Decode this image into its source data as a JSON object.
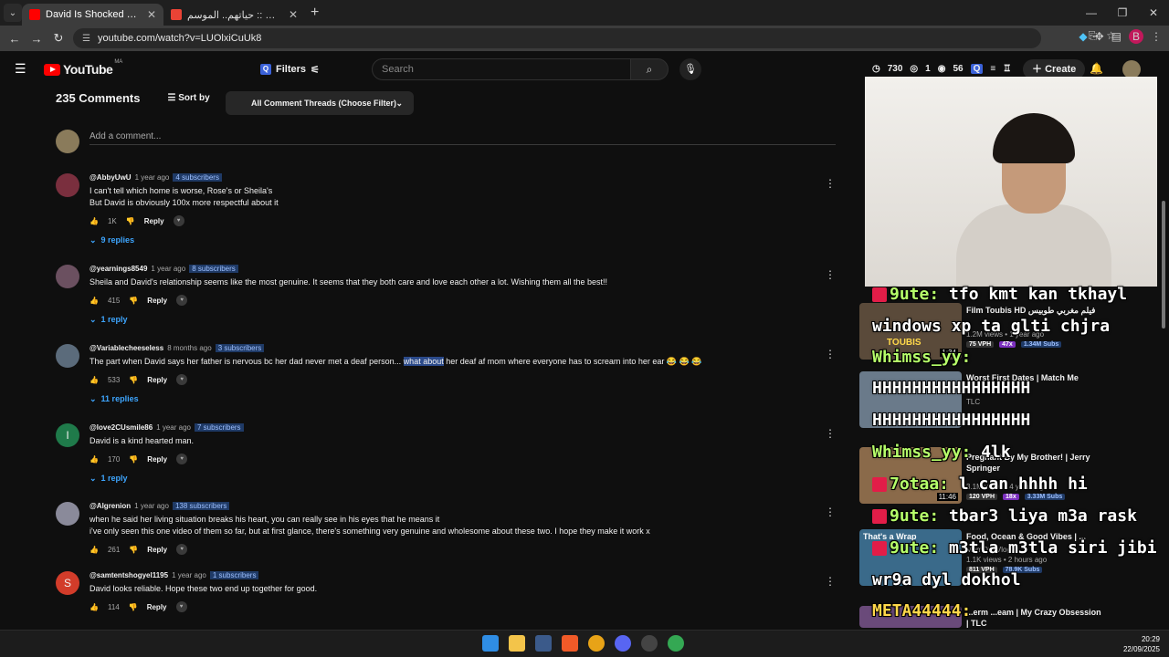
{
  "browser": {
    "tabs": [
      {
        "title": "David Is Shocked Sheila Is Livin",
        "color": "#ff0000"
      },
      {
        "title": "مدي 1 تي في :: حياتهم.. الموسم",
        "color": "#ea4335"
      }
    ],
    "url": "youtube.com/watch?v=LUOlxiCuUk8"
  },
  "header": {
    "region": "MA",
    "filters_label": "Filters",
    "search_placeholder": "Search",
    "stat_views": "730",
    "stat_likes": "1",
    "stat_watching": "56",
    "create_label": "Create"
  },
  "comments": {
    "count_label": "235 Comments",
    "sort_label": "Sort by",
    "thread_filter": "All Comment Threads (Choose Filter)",
    "add_placeholder": "Add a comment...",
    "items": [
      {
        "author": "@AbbyUwU",
        "time": "1 year ago",
        "subs": "4 subscribers",
        "lines": [
          "I can't tell which home is worse, Rose's or Sheila's",
          "But David is obviously 100x more respectful about it"
        ],
        "likes": "1K",
        "replies": "9 replies",
        "avatar": "#7a2f3e"
      },
      {
        "author": "@yearnings8549",
        "time": "1 year ago",
        "subs": "8 subscribers",
        "lines": [
          "Sheila and David's relationship seems like the most genuine. It seems that they both care and love each other a lot. Wishing them all the best!!"
        ],
        "likes": "415",
        "replies": "1 reply",
        "avatar": "#6b5060"
      },
      {
        "author": "@Variablecheeseless",
        "time": "8 months ago",
        "subs": "3 subscribers",
        "text_pre": "The part when David says her father is nervous bc her dad never met a deaf person... ",
        "text_hl": "what about",
        "text_post": " her deaf af mom where everyone has to scream into her ear 😂 😂 😂",
        "likes": "533",
        "replies": "11 replies",
        "avatar": "#5b6b7b"
      },
      {
        "author": "@love2CUsmile86",
        "time": "1 year ago",
        "subs": "7 subscribers",
        "lines": [
          "David is a kind hearted man."
        ],
        "likes": "170",
        "replies": "1 reply",
        "avatar": "#1f7a4a",
        "initial": "I"
      },
      {
        "author": "@Algrenion",
        "time": "1 year ago",
        "subs": "138 subscribers",
        "lines": [
          "when he said her living situation breaks his heart, you can really see in his eyes that he means it",
          "i've only seen this one video of them so far, but at first glance, there's something very genuine and wholesome about these two. I hope they make it work x"
        ],
        "likes": "261",
        "avatar": "#8a8a9a"
      },
      {
        "author": "@samtentshogyel1195",
        "time": "1 year ago",
        "subs": "1 subscribers",
        "lines": [
          "David looks reliable. Hope these two end up together for good."
        ],
        "likes": "114",
        "avatar": "#d23c2a",
        "initial": "S"
      }
    ],
    "reply_label": "Reply"
  },
  "sidebar": {
    "videos": [
      {
        "title": "Film Toubis HD فيلم مغربي طوبيس",
        "channel": "",
        "views": "1.2M views • 1 year ago",
        "vph": "75 VPH",
        "mult": "47x",
        "subs": "1.34M Subs",
        "thumb_text": "TOUBIS",
        "duration": "1:34"
      },
      {
        "title": "Worst First Dates | Match Me",
        "channel": "TLC",
        "views": "",
        "vph": "",
        "mult": "",
        "subs": ""
      },
      {
        "title": "Pregnant By My Brother! | Jerry Springer",
        "channel": "",
        "views": "3.1M views • 4 years ago",
        "vph": "120 VPH",
        "mult": "18x",
        "subs": "3.33M Subs",
        "duration": "11:46"
      },
      {
        "title": "Food, Ocean & Good Vibes | ...",
        "channel": "MomOf4 Vlogs",
        "views": "1.1K views • 2 hours ago",
        "vph": "811 VPH",
        "mult": "",
        "subs": "78.9K Subs",
        "thumb_text": "That's a Wrap"
      },
      {
        "title": "...erm ...eam | My Crazy Obsession | TLC",
        "channel": "",
        "views": "",
        "vph": "",
        "mult": "",
        "subs": ""
      }
    ],
    "chat": [
      {
        "user": "9ute:",
        "msg": " tfo kmt kan tkhayl"
      },
      {
        "user": "",
        "msg": "windows xp ta glti chjra"
      },
      {
        "user": "Whimss_yy:",
        "msg": ""
      },
      {
        "user": "",
        "msg": "HHHHHHHHHHHHHHHH"
      },
      {
        "user": "",
        "msg": "HHHHHHHHHHHHHHHH"
      },
      {
        "user": "Whimss_yy:",
        "msg": " 4lk"
      },
      {
        "user": "7otaa:",
        "msg": " l can hhhh hi"
      },
      {
        "user": "9ute:",
        "msg": " tbar3 liya m3a rask"
      },
      {
        "user": "9ute:",
        "msg": " m3tla m3tla siri jibi"
      },
      {
        "user": "",
        "msg": "wr9a dyl dokhol"
      },
      {
        "user": "META44444:",
        "msg": ""
      }
    ]
  },
  "taskbar": {
    "time": "20:29",
    "date": "22/09/2025"
  }
}
